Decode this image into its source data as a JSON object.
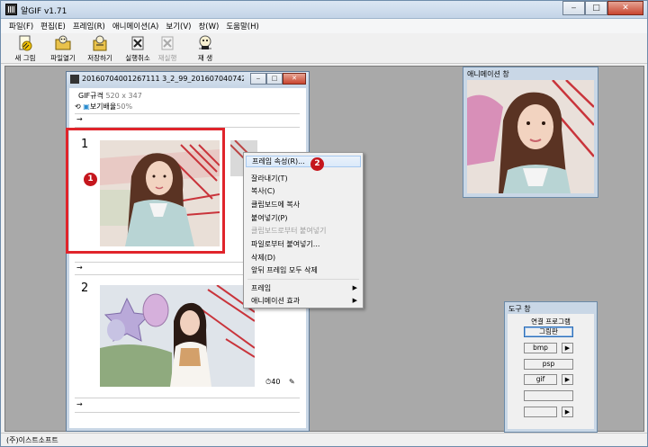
{
  "window": {
    "title": "알GIF v1.71",
    "min": "‒",
    "max": "□",
    "close": "✕"
  },
  "menu": [
    "파일(F)",
    "편집(E)",
    "프레임(R)",
    "애니메이션(A)",
    "보기(V)",
    "창(W)",
    "도움말(H)"
  ],
  "toolbar": [
    {
      "label": "새 그림",
      "icon": "new-image-icon",
      "enabled": true
    },
    {
      "label": "파일열기",
      "icon": "open-file-icon",
      "enabled": true
    },
    {
      "label": "저장하기",
      "icon": "save-icon",
      "enabled": true
    },
    {
      "label": "실행취소",
      "icon": "undo-icon",
      "enabled": true
    },
    {
      "label": "재실행",
      "icon": "redo-icon",
      "enabled": false
    },
    {
      "label": "재 생",
      "icon": "play-icon",
      "enabled": true
    }
  ],
  "document": {
    "title": "20160704001267111 3_2_99_20160704074207.j...",
    "info": {
      "size_label": "GIF규격",
      "size_value": "520 x 347",
      "zoom_label": "보기배율",
      "zoom_value": "50%"
    },
    "frames": [
      {
        "number": "1"
      },
      {
        "number": "2",
        "delay": "40"
      }
    ]
  },
  "callouts": {
    "first": "1",
    "second": "2"
  },
  "context_menu": [
    {
      "label": "프레임 속성(R)...",
      "enabled": true,
      "highlighted": true
    },
    {
      "label": "잘라내기(T)",
      "enabled": true
    },
    {
      "label": "복사(C)",
      "enabled": true
    },
    {
      "label": "클립보드에 복사",
      "enabled": true
    },
    {
      "label": "붙여넣기(P)",
      "enabled": true
    },
    {
      "label": "클립보드로부터 붙여넣기",
      "enabled": false
    },
    {
      "label": "파일로부터 붙여넣기...",
      "enabled": true
    },
    {
      "label": "삭제(D)",
      "enabled": true
    },
    {
      "label": "앞뒤 프레임 모두 삭제",
      "enabled": true
    },
    {
      "label": "프레임",
      "enabled": true,
      "submenu": true
    },
    {
      "label": "애니메이션 효과",
      "enabled": true,
      "submenu": true
    }
  ],
  "animation_window": {
    "title": "애니메이션 창"
  },
  "tool_window": {
    "title": "도구 창",
    "section_label": "연결 프로그램",
    "paint_button": "그림판",
    "rows": [
      "bmp",
      "psp",
      "gif",
      "",
      ""
    ]
  },
  "status": {
    "text": "(주)이스트소프트"
  },
  "colors": {
    "selection": "#e0242b",
    "callout": "#c5161d",
    "workspace": "#a9a9a9"
  }
}
